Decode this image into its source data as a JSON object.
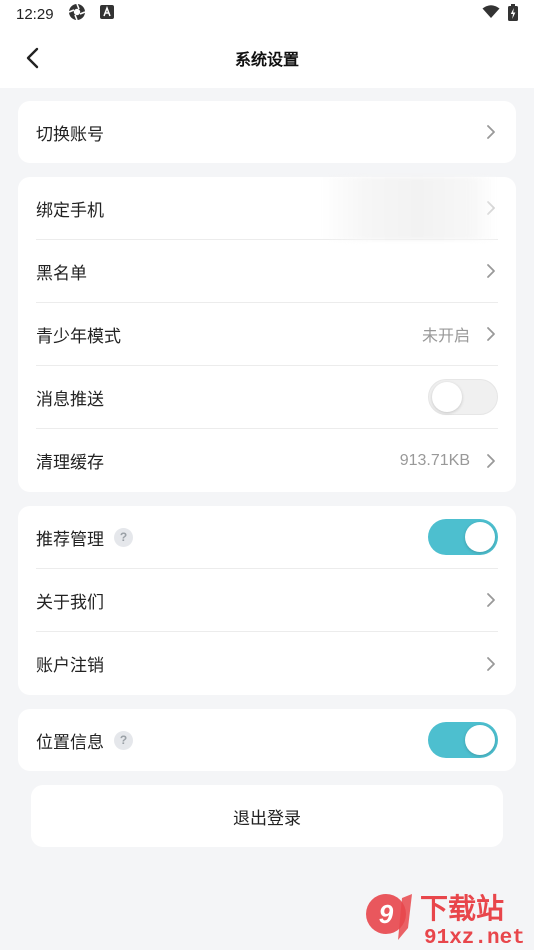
{
  "status_bar": {
    "time": "12:29"
  },
  "header": {
    "title": "系统设置"
  },
  "group1": {
    "switch_account": "切换账号"
  },
  "group2": {
    "bind_phone": "绑定手机",
    "blacklist": "黑名单",
    "teen_mode": "青少年模式",
    "teen_mode_value": "未开启",
    "message_push": "消息推送",
    "message_push_on": false,
    "clear_cache": "清理缓存",
    "cache_size": "913.71KB"
  },
  "group3": {
    "recommend_manage": "推荐管理",
    "recommend_manage_on": true,
    "about_us": "关于我们",
    "account_cancel": "账户注销"
  },
  "group4": {
    "location_info": "位置信息",
    "location_info_on": true
  },
  "logout": {
    "label": "退出登录"
  },
  "watermark": {
    "brand": "下载站",
    "site": "91xz.net"
  },
  "colors": {
    "accent": "#4dbfcf",
    "background": "#f4f5f7"
  },
  "icons": {
    "help": "?"
  }
}
